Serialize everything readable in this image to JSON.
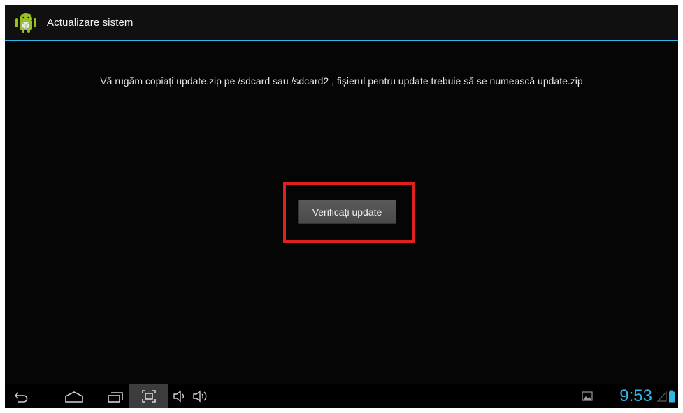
{
  "app": {
    "title": "Actualizare sistem",
    "icon": "android-robot-icon"
  },
  "main": {
    "instructions": "Vă rugăm copiați update.zip pe /sdcard sau /sdcard2 , fișierul pentru update trebuie să se numească update.zip",
    "check_button_label": "Verificați update"
  },
  "status_bar": {
    "time": "9:53",
    "icons": [
      "back-icon",
      "home-icon",
      "recent-apps-icon",
      "screenshot-icon",
      "volume-down-icon",
      "volume-up-icon",
      "gallery-notification-icon",
      "signal-icon",
      "battery-icon"
    ]
  },
  "colors": {
    "accent": "#33b5e5",
    "highlight": "#e0201f",
    "background": "#050505",
    "button": "#4f4f4f"
  }
}
